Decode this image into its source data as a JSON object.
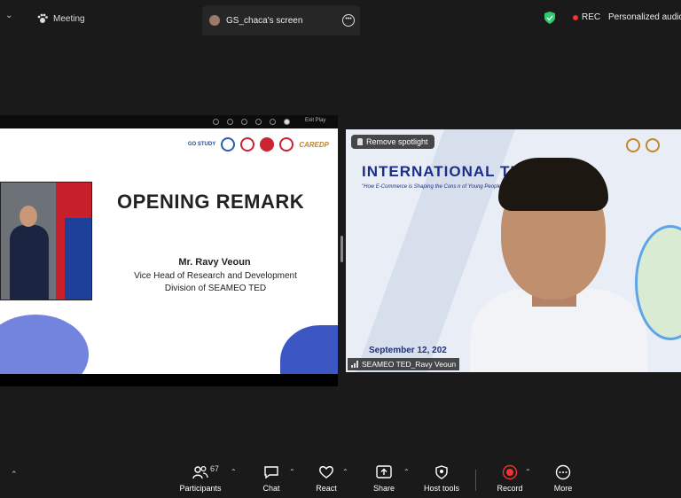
{
  "topbar": {
    "meeting_label": "Meeting",
    "screen_tab_label": "GS_chaca's screen",
    "rec_label": "REC",
    "personalized_label": "Personalized audio"
  },
  "slide": {
    "exit_label": "Exit Play",
    "logo_text": "GO STUDY",
    "caredp_text": "CAREDP",
    "title": "OPENING REMARK",
    "speaker_name": "Mr. Ravy Veoun",
    "speaker_role_line1": "Vice Head of Research and Development",
    "speaker_role_line2": "Division of SEAMEO TED"
  },
  "video": {
    "spotlight_label": "Remove spotlight",
    "title": "INTERNATIONAL     TH TALK",
    "subtitle": "\"How E-Commerce is Shaping the Cons                              n of Young People\"",
    "date": "September 12, 202",
    "participant_name": "SEAMEO TED_Ravy Veoun"
  },
  "toolbar": {
    "participants_label": "Participants",
    "participants_count": "67",
    "chat_label": "Chat",
    "react_label": "React",
    "share_label": "Share",
    "host_tools_label": "Host tools",
    "record_label": "Record",
    "more_label": "More"
  },
  "colors": {
    "background": "#1a1a1a",
    "record_red": "#e33333",
    "shield_green": "#2ecc71",
    "slide_blue": "#1b2f8a"
  }
}
